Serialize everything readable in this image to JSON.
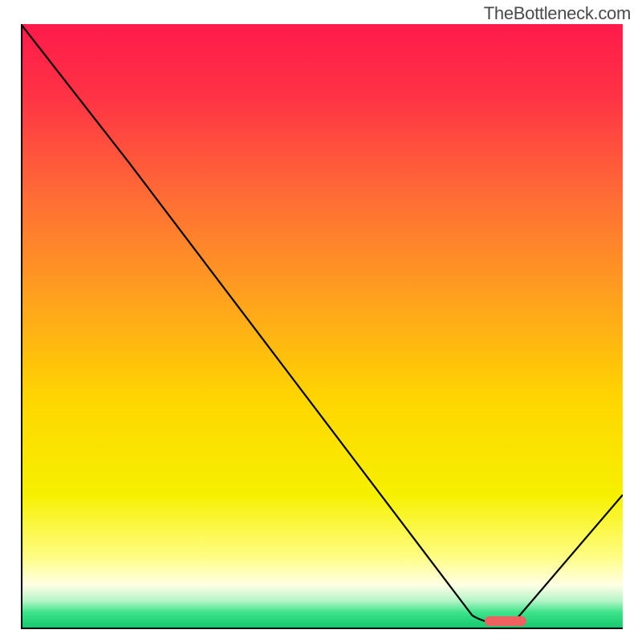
{
  "watermark": "TheBottleneck.com",
  "chart_data": {
    "type": "line",
    "title": "",
    "xlabel": "",
    "ylabel": "",
    "xlim": [
      0,
      100
    ],
    "ylim": [
      0,
      100
    ],
    "x": [
      0,
      18,
      75,
      80,
      82,
      100
    ],
    "y": [
      100,
      77,
      2,
      1,
      1,
      22
    ],
    "gradient_stops": [
      {
        "pos": 0.0,
        "color": "#ff1a4a"
      },
      {
        "pos": 0.12,
        "color": "#ff3345"
      },
      {
        "pos": 0.28,
        "color": "#ff6a36"
      },
      {
        "pos": 0.45,
        "color": "#ffa01f"
      },
      {
        "pos": 0.62,
        "color": "#ffd500"
      },
      {
        "pos": 0.78,
        "color": "#f6f000"
      },
      {
        "pos": 0.88,
        "color": "#fffd80"
      },
      {
        "pos": 0.93,
        "color": "#ffffe5"
      },
      {
        "pos": 0.955,
        "color": "#b7f5c9"
      },
      {
        "pos": 0.975,
        "color": "#3de389"
      },
      {
        "pos": 1.0,
        "color": "#16c86e"
      }
    ],
    "marker": {
      "x_start": 77,
      "x_end": 84,
      "y": 1,
      "color": "#f06060"
    },
    "grid": false,
    "legend": false
  }
}
